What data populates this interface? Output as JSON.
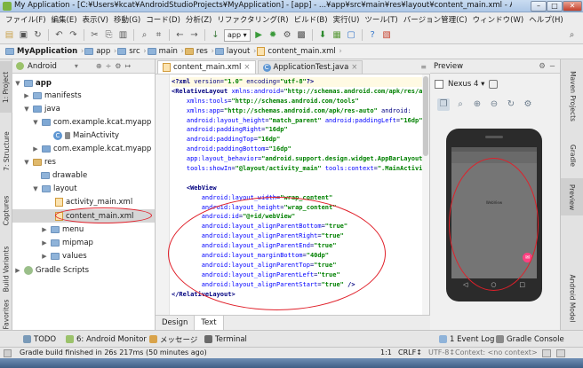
{
  "window": {
    "title": "My Application - [C:¥Users¥kcat¥AndroidStudioProjects¥MyApplication] - [app] - ...¥app¥src¥main¥res¥layout¥content_main.xml - Android S...",
    "minimize": "–",
    "maximize": "□",
    "close": "✕"
  },
  "menu": [
    "ファイル(F)",
    "編集(E)",
    "表示(V)",
    "移動(G)",
    "コード(D)",
    "分析(Z)",
    "リファクタリング(R)",
    "ビルド(B)",
    "実行(U)",
    "ツール(T)",
    "バージョン管理(C)",
    "ウィンドウ(W)",
    "ヘルプ(H)"
  ],
  "toolbar": {
    "run_config": "app ▾",
    "icons": [
      "folder-open-icon",
      "save-icon",
      "sync-icon",
      "undo-icon",
      "redo-icon",
      "cut-icon",
      "copy-icon",
      "paste-icon",
      "find-icon",
      "replace-icon",
      "back-icon",
      "forward-icon",
      "build-icon",
      "run-icon",
      "debug-icon",
      "attach-icon",
      "profile-icon",
      "sdk-manager-icon",
      "avd-manager-icon",
      "help-icon",
      "search-icon"
    ]
  },
  "breadcrumb": [
    "MyApplication",
    "app",
    "src",
    "main",
    "res",
    "layout",
    "content_main.xml"
  ],
  "left_tabs": [
    "1: Project",
    "7: Structure",
    "Captures",
    "Build Variants",
    "Favorites"
  ],
  "project": {
    "view_mode": "Android",
    "head_icons": [
      "⊕",
      "÷",
      "⚙",
      "↦"
    ],
    "tree": [
      {
        "label": "app",
        "arrow": "▼",
        "kind": "folder"
      },
      {
        "label": "manifests",
        "arrow": "▶",
        "kind": "folder"
      },
      {
        "label": "java",
        "arrow": "▼",
        "kind": "java"
      },
      {
        "label": "com.example.kcat.myapp",
        "arrow": "▼",
        "kind": "java"
      },
      {
        "label": "MainActivity",
        "arrow": "",
        "kind": "class"
      },
      {
        "label": "com.example.kcat.myapp",
        "arrow": "▶",
        "kind": "java"
      },
      {
        "label": "res",
        "arrow": "▼",
        "kind": "res"
      },
      {
        "label": "drawable",
        "arrow": "",
        "kind": "folder"
      },
      {
        "label": "layout",
        "arrow": "▼",
        "kind": "folder"
      },
      {
        "label": "activity_main.xml",
        "arrow": "",
        "kind": "file"
      },
      {
        "label": "content_main.xml",
        "arrow": "",
        "kind": "file"
      },
      {
        "label": "menu",
        "arrow": "▶",
        "kind": "folder"
      },
      {
        "label": "mipmap",
        "arrow": "▶",
        "kind": "folder"
      },
      {
        "label": "values",
        "arrow": "▶",
        "kind": "folder"
      },
      {
        "label": "Gradle Scripts",
        "arrow": "▶",
        "kind": "gradle"
      }
    ]
  },
  "editor": {
    "tabs": [
      {
        "label": "content_main.xml",
        "close": "×"
      },
      {
        "label": "ApplicationTest.java",
        "close": "×"
      }
    ],
    "tab_overflow": "≡",
    "bottom_tabs": [
      "Design",
      "Text"
    ],
    "code": [
      "<?xml version=\"1.0\" encoding=\"utf-8\"?>",
      "<RelativeLayout xmlns:android=\"http://schemas.android.com/apk/res/android\"",
      "    xmlns:tools=\"http://schemas.android.com/tools\"",
      "    xmlns:app=\"http://schemas.android.com/apk/res-auto\" android:",
      "    android:layout_height=\"match_parent\" android:paddingLeft=\"16dp\"",
      "    android:paddingRight=\"16dp\"",
      "    android:paddingTop=\"16dp\"",
      "    android:paddingBottom=\"16dp\"",
      "    app:layout_behavior=\"android.support.design.widget.AppBarLayout\"",
      "    tools:showIn=\"@layout/activity_main\" tools:context=\".MainActivity\"",
      "",
      "    <WebView",
      "        android:layout_width=\"wrap_content\"",
      "        android:layout_height=\"wrap_content\"",
      "        android:id=\"@+id/webView\"",
      "        android:layout_alignParentBottom=\"true\"",
      "        android:layout_alignParentRight=\"true\"",
      "        android:layout_alignParentEnd=\"true\"",
      "        android:layout_marginBottom=\"40dp\"",
      "        android:layout_alignParentTop=\"true\"",
      "        android:layout_alignParentLeft=\"true\"",
      "        android:layout_alignParentStart=\"true\" />",
      "</RelativeLayout>"
    ]
  },
  "preview": {
    "title": "Preview",
    "device": "Nexus 4 ▾",
    "head_icons": [
      "⚙",
      "−"
    ],
    "zoom_icons": [
      "zoom-fit-icon",
      "zoom-actual-icon",
      "zoom-in-icon",
      "zoom-out-icon",
      "refresh-icon",
      "settings-icon"
    ],
    "fab": "✉",
    "nav": [
      "◁",
      "○",
      "□"
    ]
  },
  "right_tabs": [
    "Maven Projects",
    "Gradle",
    "Preview",
    "Android Model"
  ],
  "toolwindows": {
    "left": [
      "TODO",
      "6: Android Monitor",
      "メッセージ",
      "Terminal"
    ],
    "right": [
      "1 Event Log",
      "Gradle Console"
    ]
  },
  "status": {
    "message": "Gradle build finished in 26s 217ms (50 minutes ago)",
    "position": "1:1",
    "line_sep": "CRLF↕",
    "encoding": "UTF-8↕",
    "context": "Context: <no context>"
  },
  "colors": {
    "highlight_ellipse": "#e0202a",
    "xml_tag": "#000080",
    "xml_attr": "#0000ff",
    "xml_value": "#008000"
  }
}
